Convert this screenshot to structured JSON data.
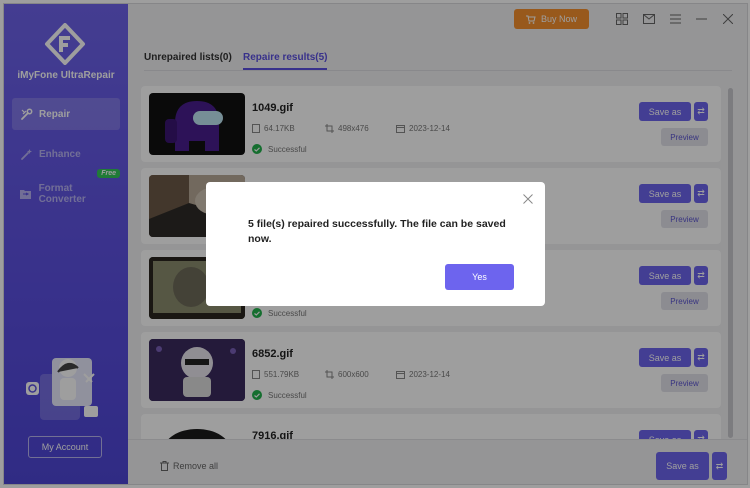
{
  "app": {
    "brand": "iMyFone UltraRepair"
  },
  "sidebar": {
    "items": [
      {
        "label": "Repair",
        "icon": "wrench-icon"
      },
      {
        "label": "Enhance",
        "icon": "magic-wand-icon"
      },
      {
        "label": "Format Converter",
        "icon": "folder-convert-icon",
        "badge": "Free"
      }
    ],
    "account_label": "My Account"
  },
  "topbar": {
    "buy_label": "Buy Now"
  },
  "tabs": {
    "unrepaired": "Unrepaired lists(0)",
    "repaired": "Repaire results(5)"
  },
  "files": [
    {
      "name": "1049.gif",
      "size": "64.17KB",
      "dims": "498x476",
      "date": "2023-12-14",
      "status": "Successful"
    },
    {
      "name": "",
      "size": "",
      "dims": "",
      "date": "",
      "status": ""
    },
    {
      "name": "",
      "size": "",
      "dims": "",
      "date": "",
      "status": "Successful"
    },
    {
      "name": "6852.gif",
      "size": "551.79KB",
      "dims": "600x600",
      "date": "2023-12-14",
      "status": "Successful"
    },
    {
      "name": "7916.gif",
      "size": "",
      "dims": "",
      "date": "",
      "status": ""
    }
  ],
  "buttons": {
    "save_as": "Save as",
    "preview": "Preview",
    "swap": "⇄"
  },
  "footer": {
    "remove_all": "Remove all",
    "save_as": "Save as"
  },
  "dialog": {
    "message": "5 file(s) repaired successfully. The file can be saved now.",
    "yes_label": "Yes"
  },
  "colors": {
    "accent": "#6d64ee",
    "sidebar": "#5b4fe0",
    "buy": "#f5902e",
    "success": "#22b24c"
  }
}
